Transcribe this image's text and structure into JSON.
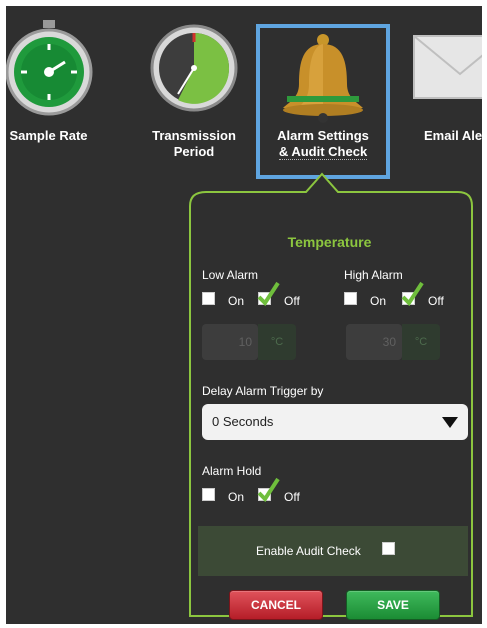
{
  "tiles": [
    {
      "label": "Sample Rate"
    },
    {
      "label_line1": "Transmission",
      "label_line2": "Period"
    },
    {
      "label_line1": "Alarm Settings",
      "label_line2": "& Audit Check"
    },
    {
      "label": "Email Aler"
    }
  ],
  "panel": {
    "title": "Temperature",
    "low_alarm": {
      "label": "Low Alarm",
      "on_label": "On",
      "off_label": "Off",
      "value": "10",
      "unit": "°C"
    },
    "high_alarm": {
      "label": "High Alarm",
      "on_label": "On",
      "off_label": "Off",
      "value": "30",
      "unit": "°C"
    },
    "delay": {
      "label": "Delay Alarm Trigger by",
      "selected": "0 Seconds"
    },
    "alarm_hold": {
      "label": "Alarm Hold",
      "on_label": "On",
      "off_label": "Off"
    },
    "audit_label": "Enable Audit Check",
    "cancel_label": "CANCEL",
    "save_label": "SAVE"
  },
  "colors": {
    "accent_green": "#8cc63f",
    "selection_blue": "#5fa5e0",
    "cancel_red": "#c9303a",
    "save_green": "#27a544"
  }
}
